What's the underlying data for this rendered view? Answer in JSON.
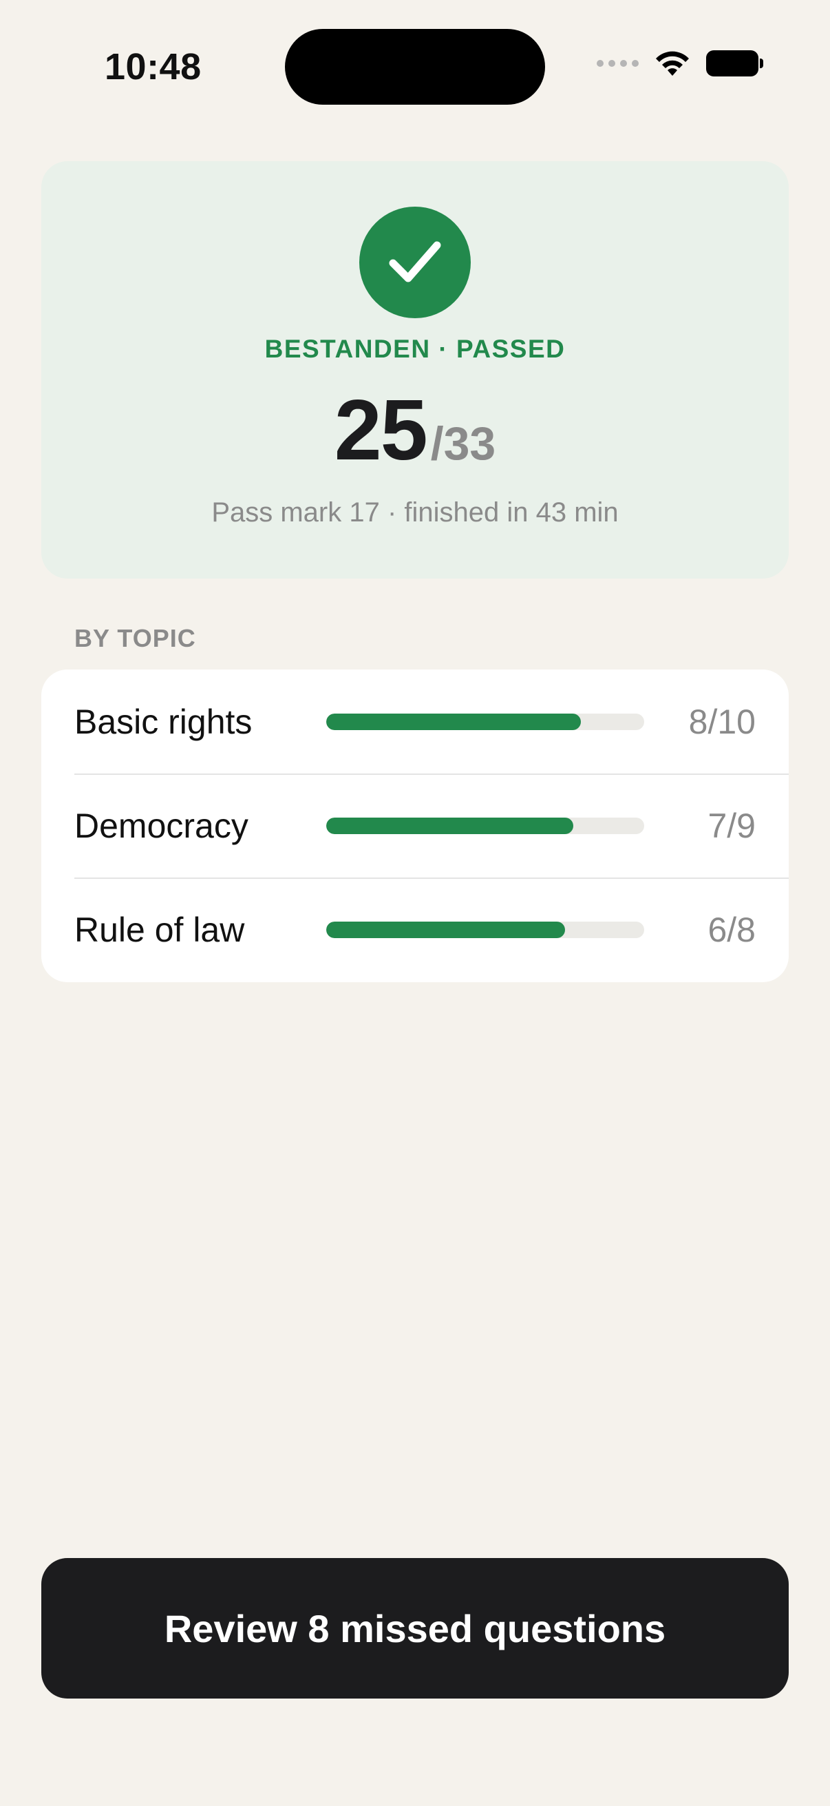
{
  "status_bar": {
    "time": "10:48"
  },
  "result": {
    "label": "BESTANDEN · PASSED",
    "score": "25",
    "total": "/33",
    "subtitle": "Pass mark 17 · finished in 43 min",
    "icon": "checkmark-icon"
  },
  "topics": {
    "header": "BY TOPIC",
    "items": [
      {
        "name": "Basic rights",
        "score": "8/10",
        "fraction": 0.8
      },
      {
        "name": "Democracy",
        "score": "7/9",
        "fraction": 0.778
      },
      {
        "name": "Rule of law",
        "score": "6/8",
        "fraction": 0.75
      }
    ]
  },
  "actions": {
    "review_label": "Review 8 missed questions"
  },
  "colors": {
    "accent": "#22894C",
    "background": "#F5F2EC",
    "card_tint": "#E9F1EA",
    "button": "#1C1C1E"
  }
}
